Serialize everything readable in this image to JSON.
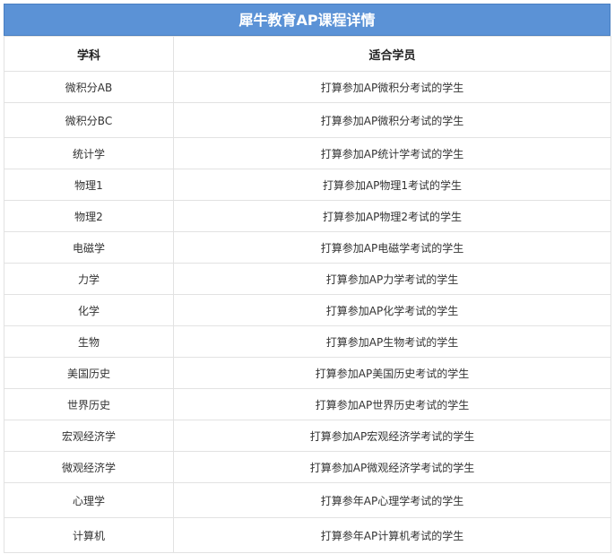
{
  "title": "犀牛教育AP课程详情",
  "headers": [
    "学科",
    "适合学员"
  ],
  "rows": [
    [
      "微积分AB",
      "打算参加AP微积分考试的学生"
    ],
    [
      "微积分BC",
      "打算参加AP微积分考试的学生"
    ],
    [
      "统计学",
      "打算参加AP统计学考试的学生"
    ],
    [
      "物理1",
      "打算参加AP物理1考试的学生"
    ],
    [
      "物理2",
      "打算参加AP物理2考试的学生"
    ],
    [
      "电磁学",
      "打算参加AP电磁学考试的学生"
    ],
    [
      "力学",
      "打算参加AP力学考试的学生"
    ],
    [
      "化学",
      "打算参加AP化学考试的学生"
    ],
    [
      "生物",
      "打算参加AP生物考试的学生"
    ],
    [
      "美国历史",
      "打算参加AP美国历史考试的学生"
    ],
    [
      "世界历史",
      "打算参加AP世界历史考试的学生"
    ],
    [
      "宏观经济学",
      "打算参加AP宏观经济学考试的学生"
    ],
    [
      "微观经济学",
      "打算参加AP微观经济学考试的学生"
    ],
    [
      "心理学",
      "打算参年AP心理学考试的学生"
    ],
    [
      "计算机",
      "打算参年AP计算机考试的学生"
    ]
  ],
  "colors": {
    "header_bg": "#5b92d6",
    "header_text": "#ffffff",
    "border": "#e2e2e2"
  }
}
